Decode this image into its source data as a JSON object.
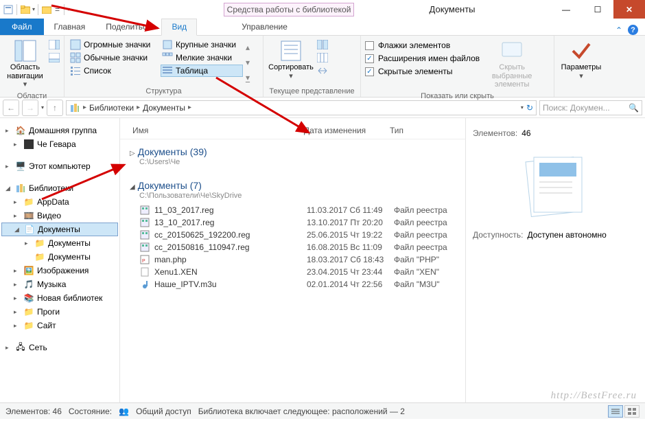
{
  "window": {
    "title": "Документы",
    "contextual_tab": "Средства работы с библиотекой"
  },
  "tabs": {
    "file": "Файл",
    "home": "Главная",
    "share": "Поделиться",
    "view": "Вид",
    "manage": "Управление"
  },
  "ribbon": {
    "panes_btn": "Область навигации",
    "panes_group": "Области",
    "layout": {
      "huge": "Огромные значки",
      "big": "Крупные значки",
      "normal": "Обычные значки",
      "small": "Мелкие значки",
      "list": "Список",
      "table": "Таблица"
    },
    "layout_group": "Структура",
    "sort_btn": "Сортировать",
    "view_group": "Текущее представление",
    "checkboxes": {
      "flags": "Флажки элементов",
      "ext": "Расширения имен файлов",
      "hidden": "Скрытые элементы"
    },
    "hide_btn": "Скрыть выбранные элементы",
    "showhide_group": "Показать или скрыть",
    "params_btn": "Параметры"
  },
  "address": {
    "crumb1": "Библиотеки",
    "crumb2": "Документы"
  },
  "search": {
    "placeholder": "Поиск: Докумен..."
  },
  "nav": {
    "homegroup": "Домашняя группа",
    "che": "Че Гевара",
    "thispc": "Этот компьютер",
    "libraries": "Библиотеки",
    "appdata": "AppData",
    "video": "Видео",
    "docs": "Документы",
    "docs_sub1": "Документы",
    "docs_sub2": "Документы",
    "images": "Изображения",
    "music": "Музыка",
    "newlib": "Новая библиотек",
    "progi": "Проги",
    "site": "Сайт",
    "network": "Сеть"
  },
  "columns": {
    "name": "Имя",
    "date": "Дата изменения",
    "type": "Тип"
  },
  "groups": [
    {
      "title": "Документы",
      "count": "(39)",
      "path": "C:\\Users\\Че"
    },
    {
      "title": "Документы",
      "count": "(7)",
      "path": "C:\\Пользователи\\Че\\SkyDrive"
    }
  ],
  "files": [
    {
      "name": "11_03_2017.reg",
      "date": "11.03.2017 Сб 11:49",
      "type": "Файл реестра",
      "icon": "reg"
    },
    {
      "name": "13_10_2017.reg",
      "date": "13.10.2017 Пт 20:20",
      "type": "Файл реестра",
      "icon": "reg"
    },
    {
      "name": "cc_20150625_192200.reg",
      "date": "25.06.2015 Чт 19:22",
      "type": "Файл реестра",
      "icon": "reg"
    },
    {
      "name": "cc_20150816_110947.reg",
      "date": "16.08.2015 Вс 11:09",
      "type": "Файл реестра",
      "icon": "reg"
    },
    {
      "name": "man.php",
      "date": "18.03.2017 Сб 18:43",
      "type": "Файл \"PHP\"",
      "icon": "php"
    },
    {
      "name": "Xenu1.XEN",
      "date": "23.04.2015 Чт 23:44",
      "type": "Файл \"XEN\"",
      "icon": "blank"
    },
    {
      "name": "Наше_IPTV.m3u",
      "date": "02.01.2014 Чт 22:56",
      "type": "Файл \"M3U\"",
      "icon": "m3u"
    }
  ],
  "details": {
    "count_label": "Элементов:",
    "count_value": "46",
    "avail_label": "Доступность:",
    "avail_value": "Доступен автономно"
  },
  "status": {
    "elements": "Элементов: 46",
    "state": "Состояние:",
    "shared": "Общий доступ",
    "lib_includes": "Библиотека включает следующее: расположений — 2"
  },
  "watermark": "http://BestFree.ru"
}
